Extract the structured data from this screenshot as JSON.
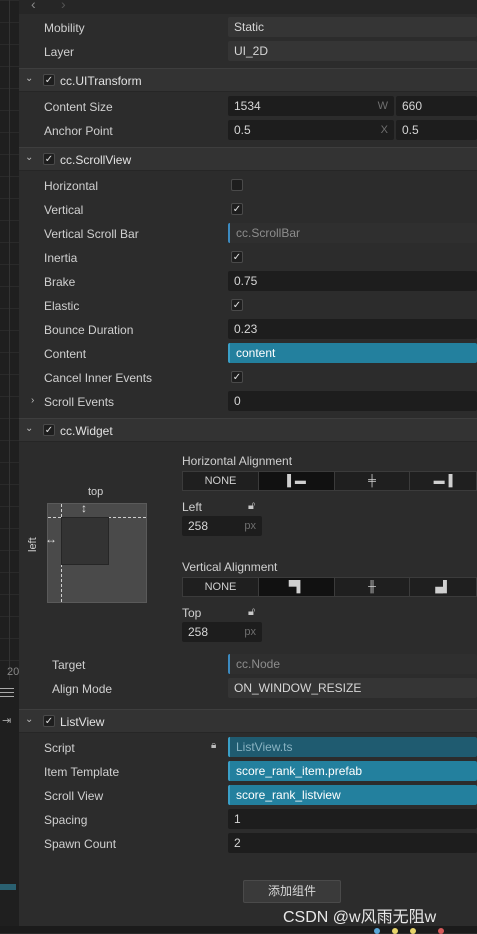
{
  "header_props": [
    {
      "label": "Mobility",
      "value": "Static"
    },
    {
      "label": "Layer",
      "value": "UI_2D"
    }
  ],
  "uitransform": {
    "title": "cc.UITransform",
    "content_size_label": "Content Size",
    "width": "1534",
    "width_axis": "W",
    "height": "660",
    "anchor_label": "Anchor Point",
    "anchor_x": "0.5",
    "anchor_x_axis": "X",
    "anchor_y": "0.5"
  },
  "scrollview": {
    "title": "cc.ScrollView",
    "horizontal_label": "Horizontal",
    "horizontal_checked": false,
    "vertical_label": "Vertical",
    "vertical_checked": true,
    "vbar_label": "Vertical Scroll Bar",
    "vbar_value": "cc.ScrollBar",
    "inertia_label": "Inertia",
    "inertia_checked": true,
    "brake_label": "Brake",
    "brake_value": "0.75",
    "elastic_label": "Elastic",
    "elastic_checked": true,
    "bounce_label": "Bounce Duration",
    "bounce_value": "0.23",
    "content_label": "Content",
    "content_value": "content",
    "cancel_label": "Cancel Inner Events",
    "cancel_checked": true,
    "scroll_events_label": "Scroll Events",
    "scroll_events_value": "0"
  },
  "widget": {
    "title": "cc.Widget",
    "h_align_label": "Horizontal Alignment",
    "h_none": "NONE",
    "v_align_label": "Vertical Alignment",
    "v_none": "NONE",
    "preview_top": "top",
    "preview_left": "left",
    "left_label": "Left",
    "left_value": "258",
    "left_unit": "px",
    "top_label": "Top",
    "top_value": "258",
    "top_unit": "px",
    "target_label": "Target",
    "target_value": "cc.Node",
    "align_mode_label": "Align Mode",
    "align_mode_value": "ON_WINDOW_RESIZE"
  },
  "listview": {
    "title": "ListView",
    "script_label": "Script",
    "script_value": "ListView.ts",
    "item_template_label": "Item Template",
    "item_template_value": "score_rank_item.prefab",
    "scroll_view_label": "Scroll View",
    "scroll_view_value": "score_rank_listview",
    "spacing_label": "Spacing",
    "spacing_value": "1",
    "spawn_label": "Spawn Count",
    "spawn_value": "2"
  },
  "add_component_label": "添加组件",
  "watermark": "CSDN @w风雨无阻w",
  "left_strip_number": "20",
  "colors": {
    "accent": "#23809e",
    "panel": "#2c2c2c",
    "field": "#1d1d1d"
  }
}
